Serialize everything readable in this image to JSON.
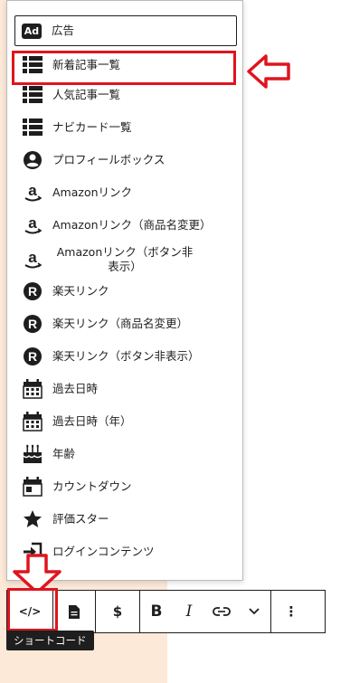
{
  "menu": {
    "items": [
      {
        "label": "広告",
        "icon": "ad-icon"
      },
      {
        "label": "新着記事一覧",
        "icon": "list-icon"
      },
      {
        "label": "人気記事一覧",
        "icon": "list-icon"
      },
      {
        "label": "ナビカード一覧",
        "icon": "list-icon"
      },
      {
        "label": "プロフィールボックス",
        "icon": "user-circle-icon"
      },
      {
        "label": "Amazonリンク",
        "icon": "amazon-icon"
      },
      {
        "label": "Amazonリンク（商品名変更）",
        "icon": "amazon-icon"
      },
      {
        "label": "Amazonリンク（ボタン非表示）",
        "icon": "amazon-icon"
      },
      {
        "label": "楽天リンク",
        "icon": "rakuten-icon"
      },
      {
        "label": "楽天リンク（商品名変更）",
        "icon": "rakuten-icon"
      },
      {
        "label": "楽天リンク（ボタン非表示）",
        "icon": "rakuten-icon"
      },
      {
        "label": "過去日時",
        "icon": "calendar-icon"
      },
      {
        "label": "過去日時（年）",
        "icon": "calendar-icon"
      },
      {
        "label": "年齢",
        "icon": "cake-icon"
      },
      {
        "label": "カウントダウン",
        "icon": "calendar-icon"
      },
      {
        "label": "評価スター",
        "icon": "star-icon"
      },
      {
        "label": "ログインコンテンツ",
        "icon": "login-icon"
      }
    ]
  },
  "toolbar": {
    "shortcode_symbol": "</>",
    "dollar": "$",
    "bold": "B",
    "italic": "I",
    "more": "⋮"
  },
  "tooltip": {
    "label": "ショートコード"
  },
  "colors": {
    "highlight": "#e0141e",
    "dark": "#1e1e1e",
    "background_panel": "#fde9d8"
  }
}
